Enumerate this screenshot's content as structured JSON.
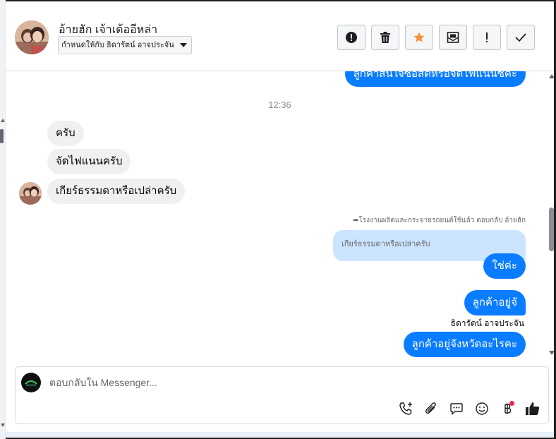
{
  "header": {
    "contact_name": "อ้ายฮัก เจ้าเด้ออีหล่า",
    "assignee": "กำหนดให้กับ ธิดารัตน์ อาจประจัน",
    "actions": [
      {
        "name": "spam-button",
        "icon": "alert-circle-icon"
      },
      {
        "name": "delete-button",
        "icon": "trash-icon"
      },
      {
        "name": "follow-up-button",
        "icon": "star-icon"
      },
      {
        "name": "mark-unread-button",
        "icon": "envelope-icon"
      },
      {
        "name": "priority-button",
        "icon": "exclamation-icon"
      },
      {
        "name": "mark-done-button",
        "icon": "check-icon"
      }
    ]
  },
  "thread": {
    "top_partial_message": "ลูกค้าสนใจซื้อสดหรือจัดไฟแนนซ์คะ",
    "timestamp": "12:36",
    "incoming": [
      "ครับ",
      "จัดไฟแนนครับ",
      "เกียร์ธรรมดาหรือเปล่าครับ"
    ],
    "reply_meta": "โรงงานผลิตและกระจายรถยนต์ใช้แล้ว ตอบกลับ อ้ายฮัก",
    "reply_quote": "เกียร์ธรรมดาหรือเปล่าครับ",
    "reply_message": "ใช่ค่ะ",
    "outgoing_1": "ลูกค้าอยู่จั",
    "sender_name": "ธิดารัตน์ อาจประจัน",
    "outgoing_2": "ลูกค้าอยู่จังหวัดอะไรคะ"
  },
  "composer": {
    "placeholder": "ตอบกลับใน Messenger...",
    "icons": [
      "call-add-icon",
      "paperclip-icon",
      "saved-reply-icon",
      "emoji-icon",
      "baht-payment-icon",
      "thumbs-up-icon"
    ]
  },
  "colors": {
    "accent": "#0a7cff",
    "incoming_bubble": "#f0f0f0",
    "quote_bubble": "#cce4ff",
    "star": "#f7923a",
    "badge": "#f02849"
  }
}
